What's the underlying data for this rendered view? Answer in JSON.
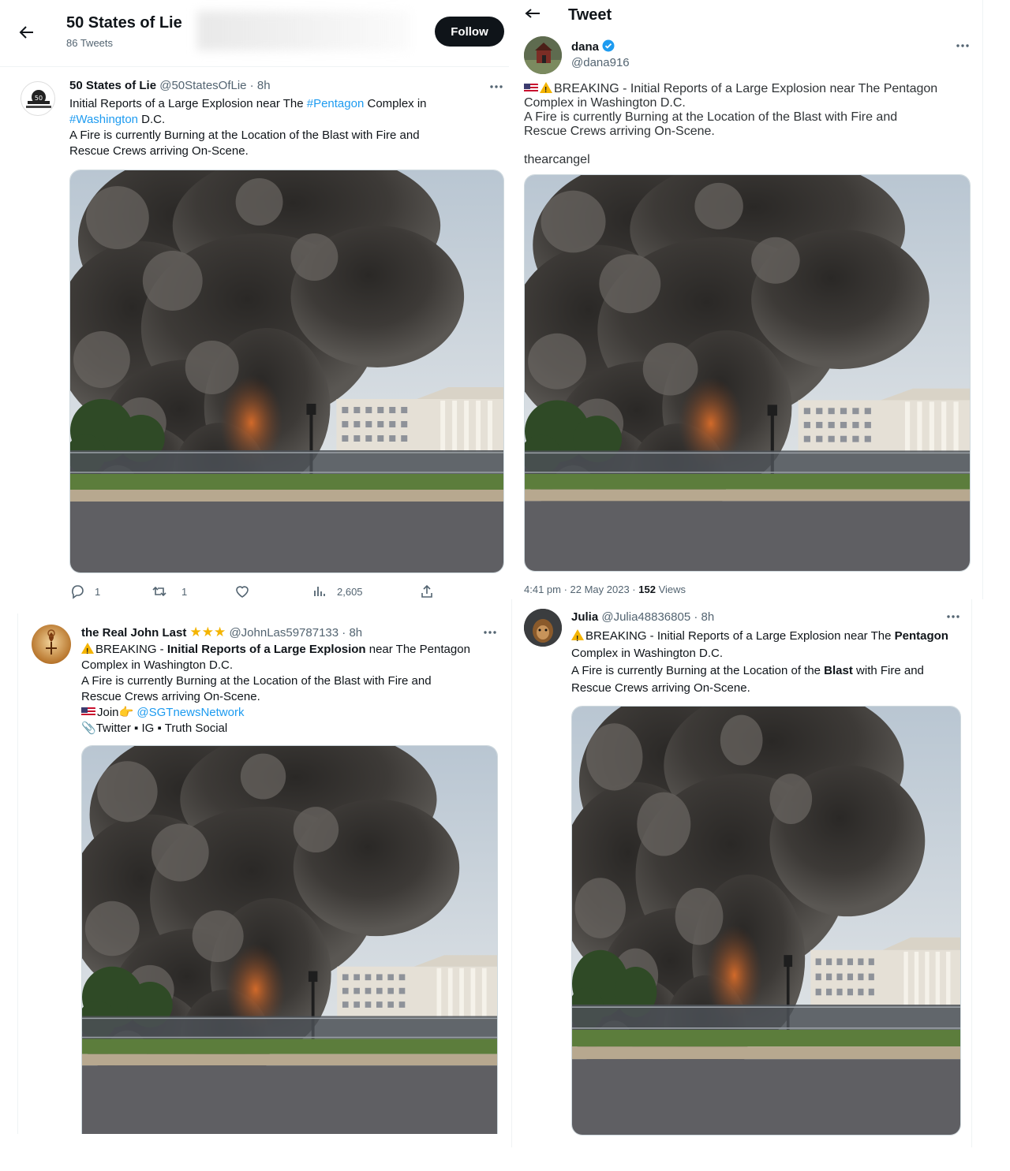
{
  "tl": {
    "header": {
      "title": "50 States of Lie",
      "subtitle": "86 Tweets",
      "follow_label": "Follow"
    },
    "tweet": {
      "name": "50 States of Lie",
      "handle": "@50StatesOfLie",
      "time": "8h",
      "line1_pre": "Initial Reports of a Large Explosion near The ",
      "hashtag1": "#Pentagon",
      "line1_post": " Complex in",
      "hashtag2": "#Washington",
      "line2_post": " D.C.",
      "line3": "A Fire is currently Burning at the Location of the Blast with Fire and",
      "line4": "Rescue Crews arriving On-Scene.",
      "replies": "1",
      "retweets": "1",
      "views": "2,605"
    }
  },
  "tr": {
    "header": {
      "title": "Tweet"
    },
    "tweet": {
      "name": "dana",
      "handle": "@dana916",
      "line1": "BREAKING - Initial Reports of a Large Explosion near The Pentagon",
      "line2": "Complex in Washington D.C.",
      "line3": "A Fire is currently Burning at the Location of the Blast with Fire and",
      "line4": "Rescue Crews arriving On-Scene.",
      "credit": "thearcangel",
      "timestamp": "4:41 pm · 22 May 2023 · ",
      "views_count": "152",
      "views_label": " Views"
    }
  },
  "bl": {
    "tweet": {
      "name": "the Real John Last",
      "stars": "★★★",
      "handle": "@JohnLas59787133",
      "time": "8h",
      "line1_a": "BREAKING - ",
      "line1_b": "Initial Reports of a Large Explosion",
      "line1_c": " near The Pentagon",
      "line2": "Complex in Washington D.C.",
      "line3": "A Fire is currently Burning at the Location of the Blast with Fire and",
      "line4": "Rescue Crews arriving On-Scene.",
      "join_label": "Join",
      "join_emoji": "👉",
      "join_link": "@SGTnewsNetwork",
      "links_emoji": "📎",
      "links": "Twitter ▪ IG ▪ Truth Social"
    }
  },
  "br": {
    "tweet": {
      "name": "Julia",
      "handle": "@Julia48836805",
      "time": "8h",
      "line1_a": "BREAKING - Initial Reports of a Large Explosion near The ",
      "line1_b": "Pentagon",
      "line2": "Complex in Washington D.C.",
      "line3_a": "A Fire is currently Burning at the Location of the ",
      "line3_b": "Blast",
      "line3_c": " with Fire and",
      "line4": "Rescue Crews arriving On-Scene."
    }
  },
  "separators": {
    "dot": " · "
  },
  "colors": {
    "link": "#1d9bf0",
    "muted": "#536471",
    "text": "#0f1419",
    "follow_bg": "#0f1419"
  }
}
